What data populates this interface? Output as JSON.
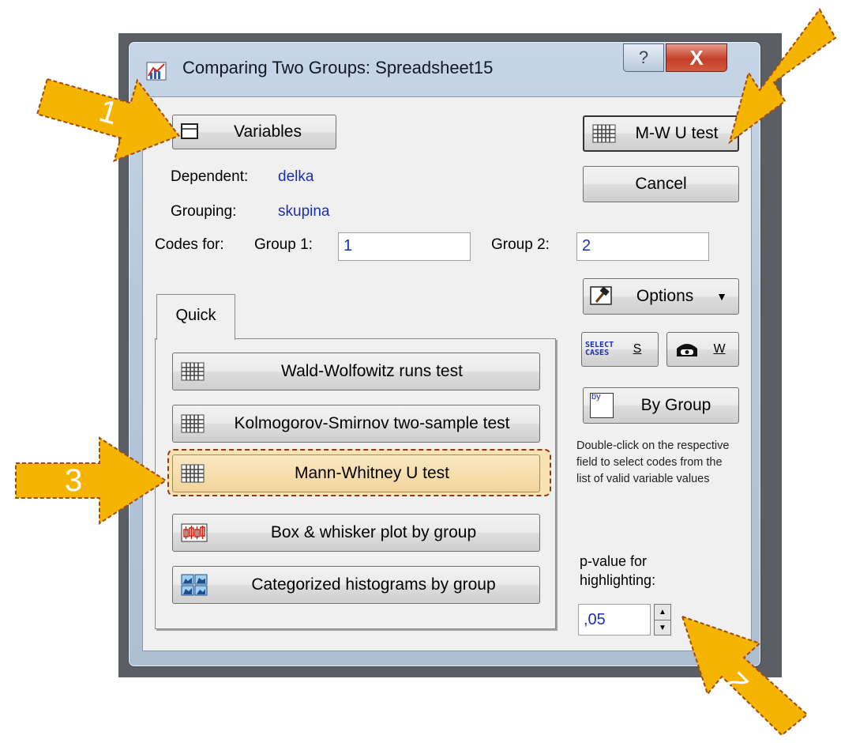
{
  "window": {
    "title": "Comparing Two Groups: Spreadsheet15",
    "help_glyph": "?",
    "close_glyph": "X"
  },
  "buttons": {
    "variables": "Variables",
    "mwu": "M-W U test",
    "cancel": "Cancel",
    "options": "Options",
    "select_cases_icon_text": "SELECT CASES",
    "select_cases_short": "S",
    "weight_short": "W",
    "by_group": "By Group",
    "by_group_icon_text": "by"
  },
  "variables": {
    "dependent_label": "Dependent:",
    "dependent_value": "delka",
    "grouping_label": "Grouping:",
    "grouping_value": "skupina"
  },
  "codes": {
    "label": "Codes for:",
    "group1_label": "Group 1:",
    "group1_value": "1",
    "group2_label": "Group 2:",
    "group2_value": "2"
  },
  "tabs": [
    {
      "label": "Quick"
    }
  ],
  "quick_tests": [
    {
      "label": "Wald-Wolfowitz runs test",
      "icon": "spreadsheet-icon"
    },
    {
      "label": "Kolmogorov-Smirnov two-sample test",
      "icon": "spreadsheet-icon"
    },
    {
      "label": "Mann-Whitney U test",
      "icon": "spreadsheet-icon",
      "highlighted": true
    },
    {
      "label": "Box & whisker plot by group",
      "icon": "box-whisker-icon"
    },
    {
      "label": "Categorized histograms by group",
      "icon": "histogram-icon"
    }
  ],
  "help_note": "Double-click on the respective field to select codes from the list of valid variable values",
  "pvalue": {
    "label_line1": "p-value for",
    "label_line2": "highlighting:",
    "value": ",05"
  },
  "annotations": [
    {
      "number": "1"
    },
    {
      "number": "2"
    },
    {
      "number": "3"
    },
    {
      "number": "3"
    }
  ],
  "colors": {
    "arrow": "#f5b400",
    "highlight": "#f4d79a",
    "value_blue": "#1a2fb3"
  }
}
